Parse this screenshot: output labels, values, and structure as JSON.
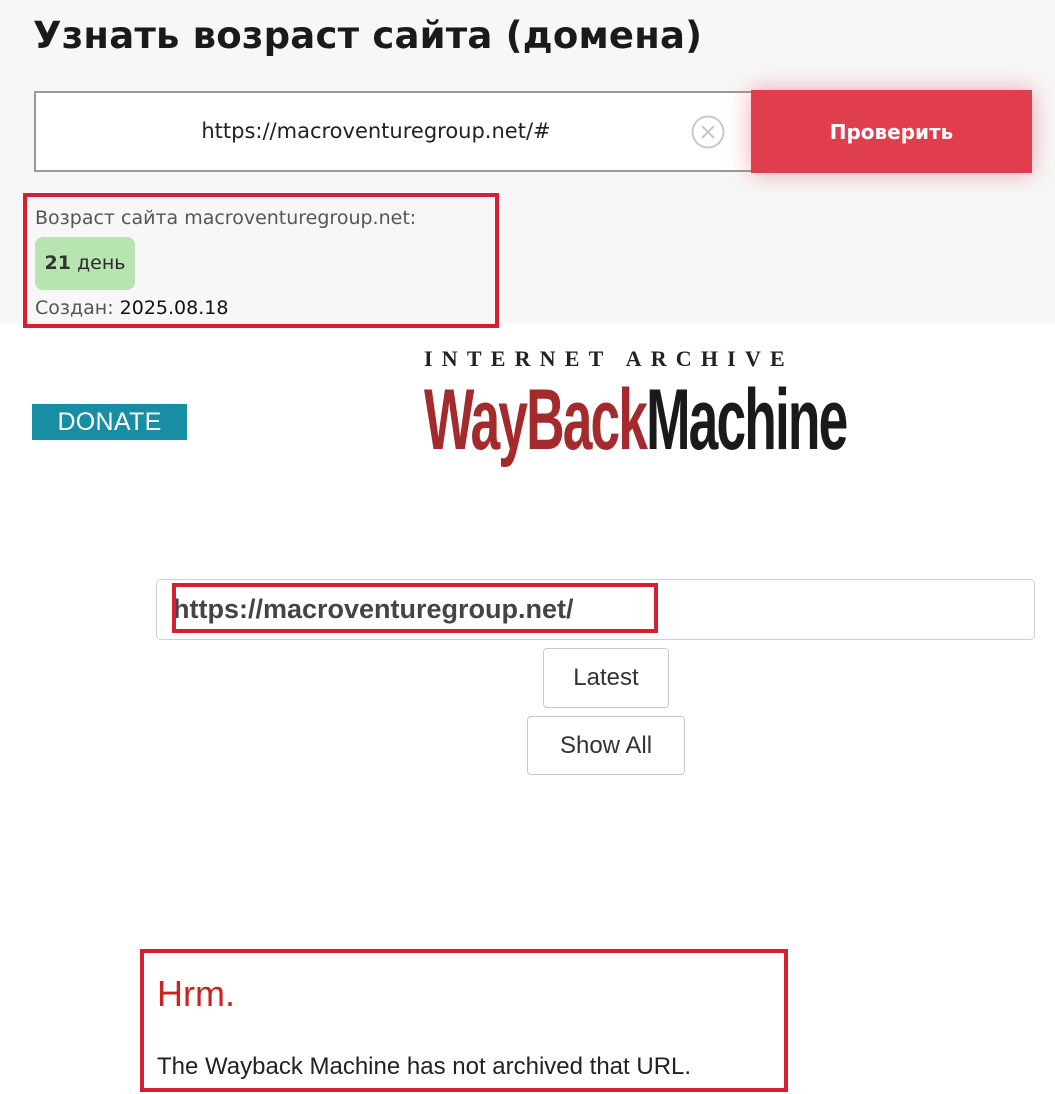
{
  "checker": {
    "title": "Узнать возраст сайта (домена)",
    "url_value": "https://macroventuregroup.net/#",
    "check_label": "Проверить",
    "result": {
      "age_label": "Возраст сайта macroventuregroup.net:",
      "age_number": "21",
      "age_unit": " день",
      "created_label": "Создан: ",
      "created_date": "2025.08.18"
    },
    "colors": {
      "accent": "#e03d4d",
      "badge": "#b7e4b0",
      "highlight": "#d71f33"
    }
  },
  "wayback": {
    "donate_label": "DONATE",
    "logo": {
      "top_text": "INTERNET ARCHIVE",
      "word_red": "WayBack",
      "word_black": "Machine"
    },
    "search_value": "https://macroventuregroup.net/",
    "latest_label": "Latest",
    "show_all_label": "Show All",
    "error_title": "Hrm.",
    "error_message": "The Wayback Machine has not archived that URL.",
    "colors": {
      "donate": "#178ea3",
      "logo_red": "#a32a2d",
      "error": "#cc2222"
    }
  },
  "icons": {
    "clear": "circle-x-icon"
  }
}
